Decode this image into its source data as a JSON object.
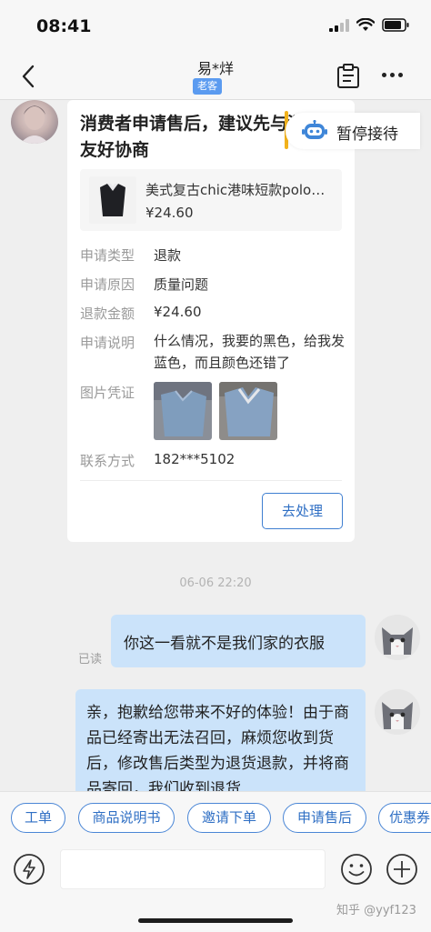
{
  "status_bar": {
    "time": "08:41"
  },
  "header": {
    "title": "易*烊",
    "badge": "老客"
  },
  "card": {
    "title": "消费者申请售后，建议先与消费者友好协商",
    "product": {
      "name": "美式复古chic港味短款polo领小背心",
      "price": "¥24.60"
    },
    "fields": [
      {
        "label": "申请类型",
        "value": "退款"
      },
      {
        "label": "申请原因",
        "value": "质量问题"
      },
      {
        "label": "退款金额",
        "value": "¥24.60"
      },
      {
        "label": "申请说明",
        "value": "什么情况，我要的黑色，给我发蓝色，而且颜色还错了"
      },
      {
        "label": "图片凭证",
        "value": ""
      },
      {
        "label": "联系方式",
        "value": "182***5102"
      }
    ],
    "action": "去处理"
  },
  "pause": {
    "label": "暂停接待"
  },
  "chat": {
    "timestamp": "06-06 22:20",
    "msg1": "你这一看就不是我们家的衣服",
    "read": "已读",
    "msg2": "亲，抱歉给您带来不好的体验！由于商品已经寄出无法召回，麻烦您收到货后，修改售后类型为退货退款，并将商品寄回，我们收到退货"
  },
  "quick_actions": [
    "工单",
    "商品说明书",
    "邀请下单",
    "申请售后",
    "优惠券"
  ],
  "watermark": "知乎 @yyf123",
  "colors": {
    "accent": "#2f6fc4",
    "bubble": "#cbe3fa",
    "badge": "#5b9bf0",
    "highlight": "#f2b21b"
  }
}
